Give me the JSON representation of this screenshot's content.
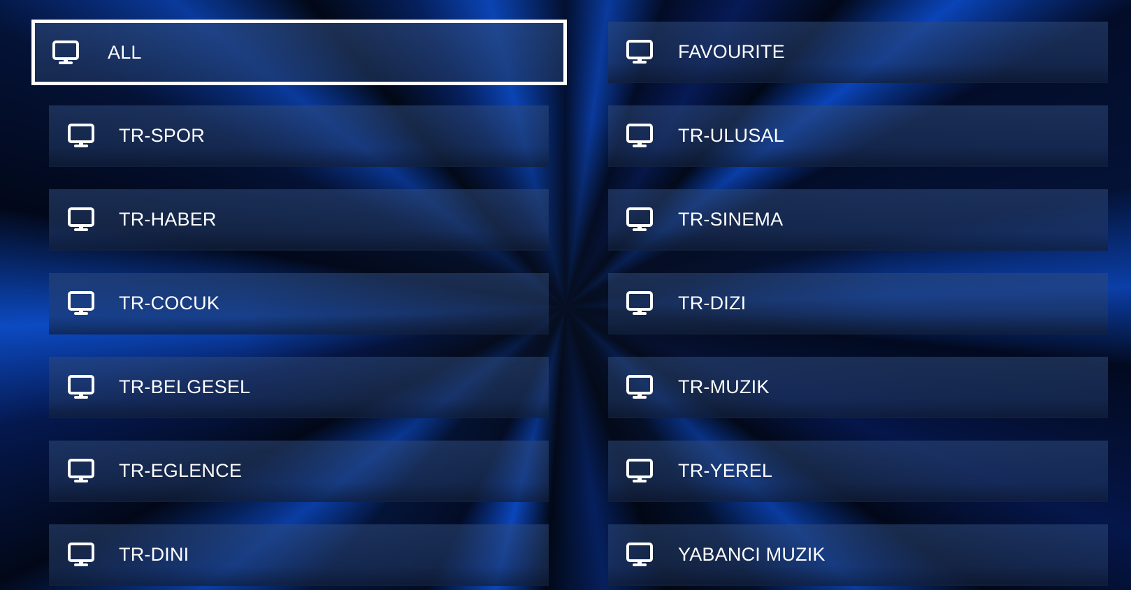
{
  "categories": {
    "items": [
      {
        "label": "ALL"
      },
      {
        "label": "FAVOURITE"
      },
      {
        "label": "TR-SPOR"
      },
      {
        "label": "TR-ULUSAL"
      },
      {
        "label": "TR-HABER"
      },
      {
        "label": "TR-SINEMA"
      },
      {
        "label": "TR-COCUK"
      },
      {
        "label": "TR-DIZI"
      },
      {
        "label": "TR-BELGESEL"
      },
      {
        "label": "TR-MUZIK"
      },
      {
        "label": "TR-EGLENCE"
      },
      {
        "label": "TR-YEREL"
      },
      {
        "label": "TR-DINI"
      },
      {
        "label": "YABANCI MUZIK"
      }
    ],
    "icon": "monitor-icon",
    "selected": "ALL"
  },
  "colors": {
    "accent_border": "#ffffff",
    "tile": "#253d66",
    "text": "#ffffff",
    "background": "#02060f"
  }
}
